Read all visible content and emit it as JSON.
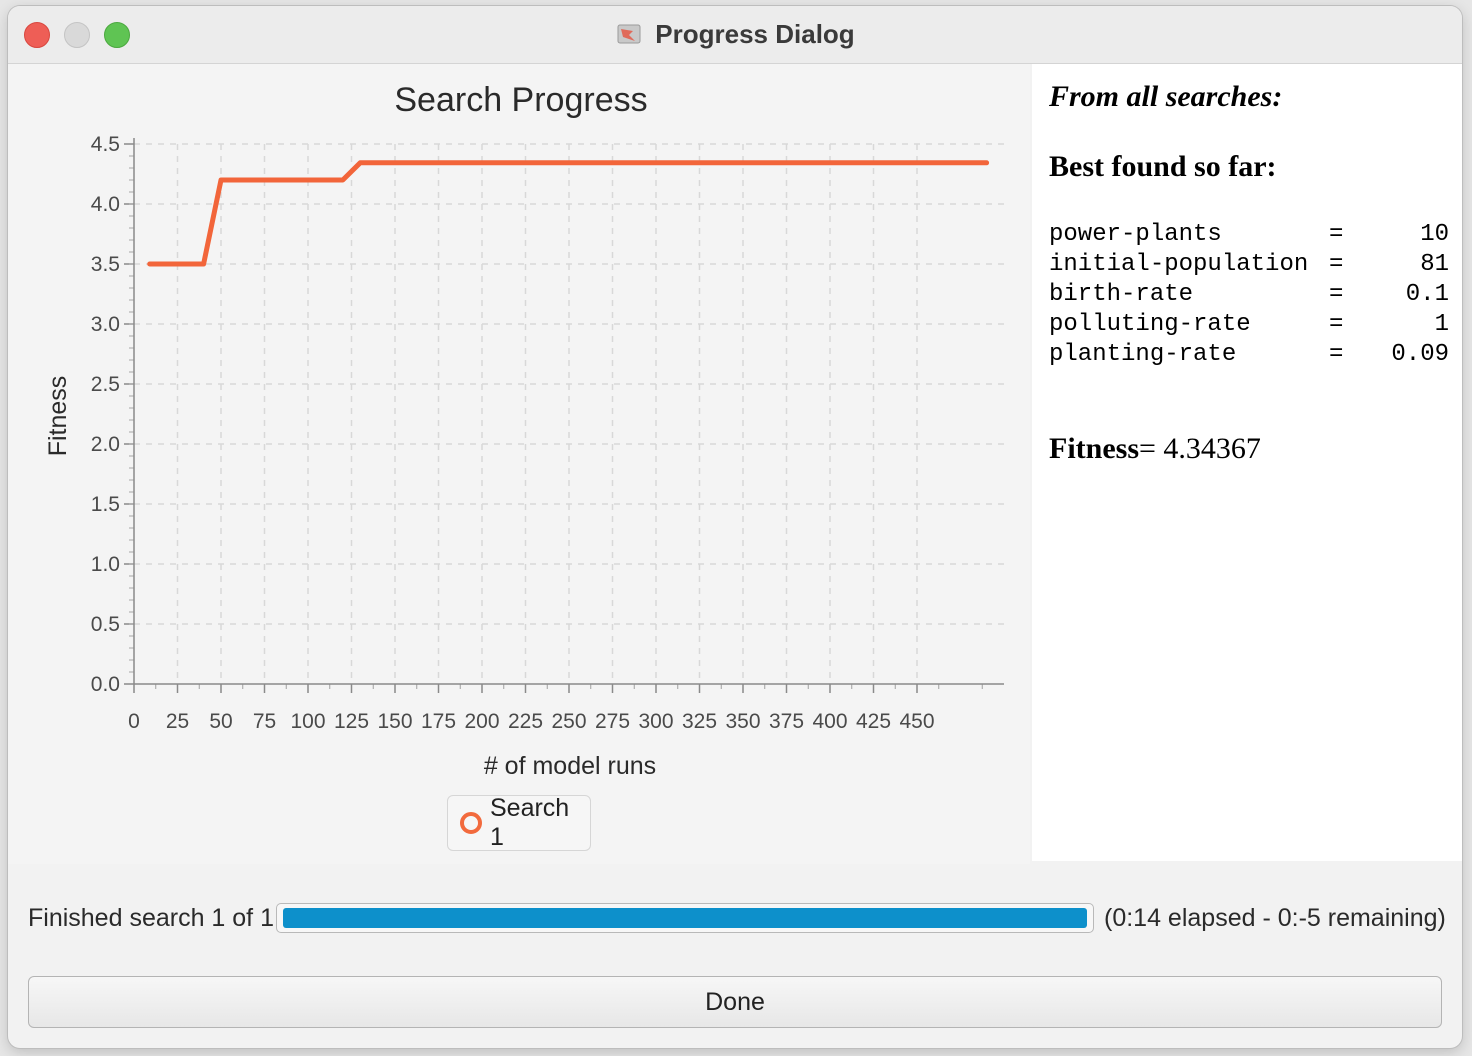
{
  "window": {
    "title": "Progress Dialog"
  },
  "chart_data": {
    "type": "line",
    "title": "Search Progress",
    "xlabel": "# of model runs",
    "ylabel": "Fitness",
    "xlim": [
      0,
      500
    ],
    "ylim": [
      0,
      4.5
    ],
    "x_ticks": [
      "0",
      "25",
      "50",
      "75",
      "100",
      "125",
      "150",
      "175",
      "200",
      "225",
      "250",
      "275",
      "300",
      "325",
      "350",
      "375",
      "400",
      "425",
      "450"
    ],
    "y_ticks": [
      "0.0",
      "0.5",
      "1.0",
      "1.5",
      "2.0",
      "2.5",
      "3.0",
      "3.5",
      "4.0",
      "4.5"
    ],
    "grid": true,
    "legend_position": "bottom-center",
    "series": [
      {
        "name": "Search 1",
        "color": "#f2653a",
        "x": [
          9,
          40,
          50,
          120,
          130,
          490
        ],
        "y": [
          3.5,
          3.5,
          4.2,
          4.2,
          4.343,
          4.343
        ]
      }
    ]
  },
  "legend": {
    "label": "Search 1"
  },
  "info": {
    "heading": "From all searches:",
    "subheading": "Best found so far:",
    "params": [
      {
        "name": "power-plants",
        "eq": "=",
        "value": "10"
      },
      {
        "name": "initial-population",
        "eq": "=",
        "value": "81"
      },
      {
        "name": "birth-rate",
        "eq": "=",
        "value": "0.1"
      },
      {
        "name": "polluting-rate",
        "eq": "=",
        "value": "1"
      },
      {
        "name": "planting-rate",
        "eq": "=",
        "value": "0.09"
      }
    ],
    "fitness_label": "Fitness",
    "fitness_value": "= 4.34367"
  },
  "status": {
    "label": "Finished search 1 of 1:",
    "progress_fraction": 1.0,
    "progress_color": "#0d90cb",
    "elapsed": "(0:14 elapsed - 0:-5 remaining)"
  },
  "done_label": "Done"
}
